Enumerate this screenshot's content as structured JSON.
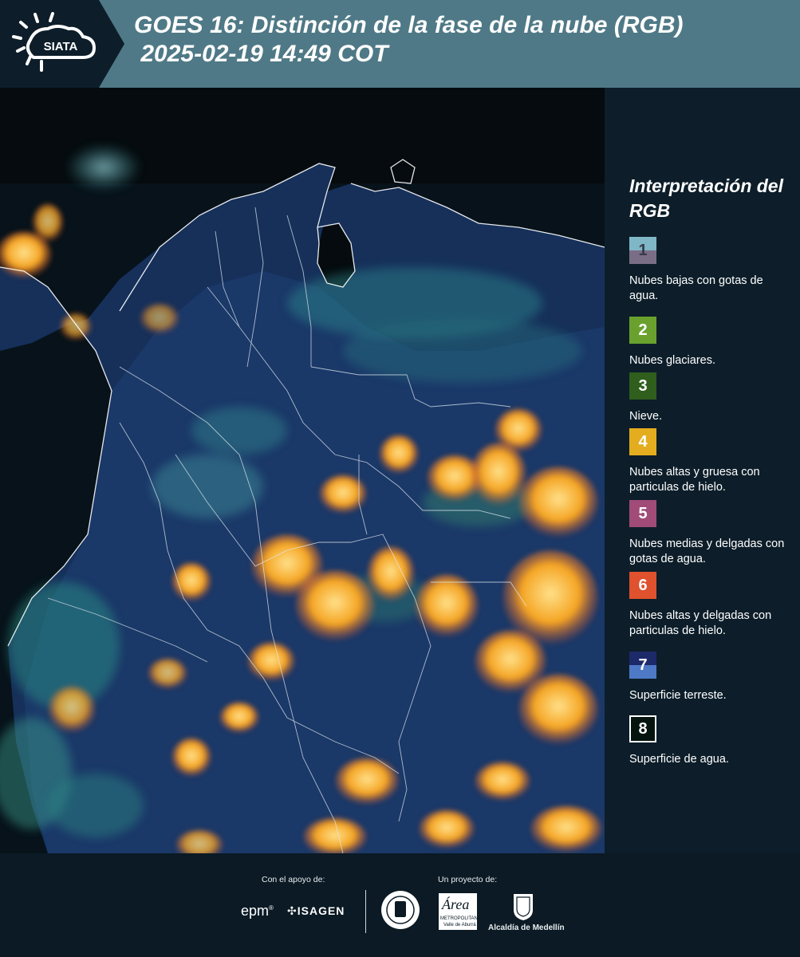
{
  "header": {
    "logo_text": "SIATA",
    "title": "GOES 16: Distinción de la fase de la nube (RGB)\n 2025-02-19 14:49 COT"
  },
  "legend": {
    "title": "Interpretación del RGB",
    "items": [
      {
        "number": "1",
        "label": "Nubes bajas con gotas de agua.",
        "color_top": "#7fb7c6",
        "color_bottom": "#7a6e86"
      },
      {
        "number": "2",
        "label": "Nubes glaciares.",
        "color_top": "#6aa12e",
        "color_bottom": "#6aa12e"
      },
      {
        "number": "3",
        "label": "Nieve.",
        "color_top": "#2f5e1d",
        "color_bottom": "#2f5e1d"
      },
      {
        "number": "4",
        "label": "Nubes altas y gruesa con particulas de hielo.",
        "color_top": "#e4ad1f",
        "color_bottom": "#e4ad1f"
      },
      {
        "number": "5",
        "label": "Nubes medias y delgadas con gotas de agua.",
        "color_top": "#a04b78",
        "color_bottom": "#a04b78"
      },
      {
        "number": "6",
        "label": "Nubes altas y delgadas con particulas de hielo.",
        "color_top": "#e0512d",
        "color_bottom": "#e0512d"
      },
      {
        "number": "7",
        "label": "Superficie terreste.",
        "color_top": "#1c2a6a",
        "color_bottom": "#4d79c6"
      },
      {
        "number": "8",
        "label": "Superficie de agua.",
        "color_top": "#05140f",
        "color_bottom": "#05140f"
      }
    ]
  },
  "footer": {
    "support_label": "Con el apoyo de:",
    "project_label": "Un proyecto de:",
    "sponsor_epm": "epm",
    "sponsor_isagen": "ISAGEN",
    "area_logo_text": "Área",
    "area_caption": "METROPOLITANA",
    "area_caption2": "Valle de Aburrá",
    "alcaldia_label": "Alcaldía de Medellín"
  }
}
